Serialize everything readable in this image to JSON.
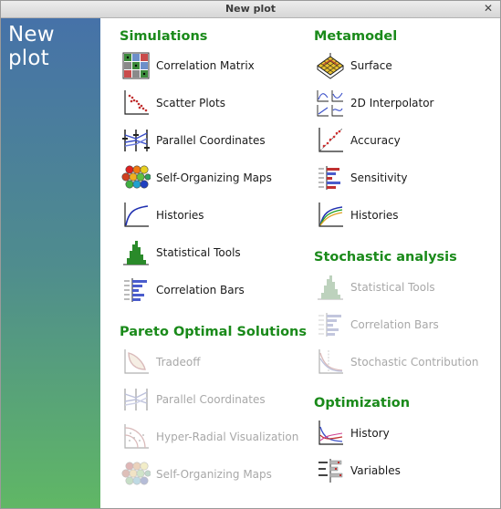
{
  "window": {
    "title": "New plot",
    "close_glyph": "✕"
  },
  "sidebar": {
    "heading": "New plot"
  },
  "sections": {
    "simulations": {
      "title": "Simulations",
      "items": [
        {
          "label": "Correlation Matrix",
          "icon": "correlation-matrix-icon",
          "enabled": true
        },
        {
          "label": "Scatter Plots",
          "icon": "scatter-plot-icon",
          "enabled": true
        },
        {
          "label": "Parallel Coordinates",
          "icon": "parallel-coordinates-icon",
          "enabled": true
        },
        {
          "label": "Self-Organizing Maps",
          "icon": "som-hexagon-icon",
          "enabled": true
        },
        {
          "label": "Histories",
          "icon": "history-curve-icon",
          "enabled": true
        },
        {
          "label": "Statistical Tools",
          "icon": "histogram-icon",
          "enabled": true
        },
        {
          "label": "Correlation Bars",
          "icon": "correlation-bars-icon",
          "enabled": true
        }
      ]
    },
    "pareto": {
      "title": "Pareto Optimal Solutions",
      "items": [
        {
          "label": "Tradeoff",
          "icon": "tradeoff-icon",
          "enabled": false
        },
        {
          "label": "Parallel Coordinates",
          "icon": "parallel-coordinates-icon",
          "enabled": false
        },
        {
          "label": "Hyper-Radial Visualization",
          "icon": "hyper-radial-icon",
          "enabled": false
        },
        {
          "label": "Self-Organizing Maps",
          "icon": "som-hexagon-icon",
          "enabled": false
        }
      ]
    },
    "metamodel": {
      "title": "Metamodel",
      "items": [
        {
          "label": "Surface",
          "icon": "surface-3d-icon",
          "enabled": true
        },
        {
          "label": "2D Interpolator",
          "icon": "interpolator-2d-icon",
          "enabled": true
        },
        {
          "label": "Accuracy",
          "icon": "accuracy-icon",
          "enabled": true
        },
        {
          "label": "Sensitivity",
          "icon": "sensitivity-icon",
          "enabled": true
        },
        {
          "label": "Histories",
          "icon": "history-curve-icon",
          "enabled": true
        }
      ]
    },
    "stochastic": {
      "title": "Stochastic analysis",
      "items": [
        {
          "label": "Statistical Tools",
          "icon": "histogram-icon",
          "enabled": false
        },
        {
          "label": "Correlation Bars",
          "icon": "correlation-bars-icon",
          "enabled": false
        },
        {
          "label": "Stochastic Contribution",
          "icon": "stochastic-contribution-icon",
          "enabled": false
        }
      ]
    },
    "optimization": {
      "title": "Optimization",
      "items": [
        {
          "label": "History",
          "icon": "optimization-history-icon",
          "enabled": true
        },
        {
          "label": "Variables",
          "icon": "variables-icon",
          "enabled": true
        }
      ]
    }
  }
}
